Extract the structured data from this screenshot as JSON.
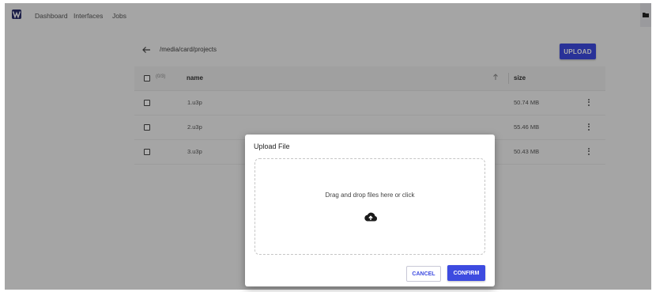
{
  "nav": {
    "logo_icon": "brand-logo-icon",
    "links": [
      "Dashboard",
      "Interfaces",
      "Jobs"
    ],
    "right_icon": "folder-icon"
  },
  "browser": {
    "path": "/media/card/projects",
    "upload_label": "UPLOAD",
    "header": {
      "count": "(0/3)",
      "name": "name",
      "size": "size"
    },
    "files": [
      {
        "name": "1.u3p",
        "size": "50.74 MB"
      },
      {
        "name": "2.u3p",
        "size": "55.46 MB"
      },
      {
        "name": "3.u3p",
        "size": "50.43 MB"
      }
    ]
  },
  "dialog": {
    "title": "Upload File",
    "drop_text": "Drag and drop files here or click",
    "cancel_label": "CANCEL",
    "confirm_label": "CONFIRM"
  },
  "colors": {
    "accent": "#3d4be0",
    "background": "#f4f4f4",
    "brand": "#2c2f6b"
  }
}
